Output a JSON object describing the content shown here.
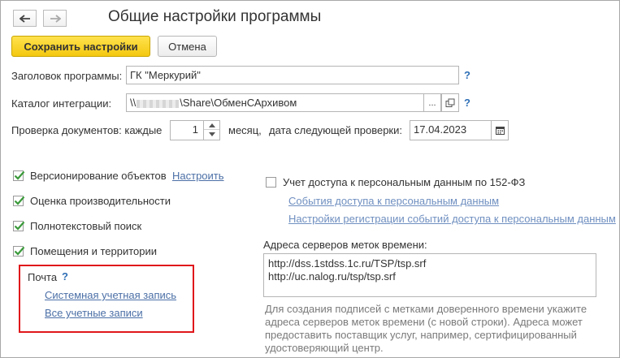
{
  "window": {
    "title": "Общие настройки программы",
    "back_icon": "arrow-left-icon",
    "forward_icon": "arrow-right-icon"
  },
  "toolbar": {
    "save_label": "Сохранить настройки",
    "cancel_label": "Отмена"
  },
  "fields": {
    "title_label": "Заголовок программы:",
    "title_value": "ГК \"Меркурий\"",
    "catalog_label": "Каталог интеграции:",
    "catalog_value_prefix": "\\\\",
    "catalog_value_suffix": "\\Share\\ОбменСАрхивом",
    "catalog_select_label": "...",
    "help": "?"
  },
  "doc_check": {
    "label": "Проверка документов:  каждые",
    "value": "1",
    "unit": "месяц,",
    "next_label": "дата следующей проверки:",
    "next_date": "17.04.2023"
  },
  "left_options": [
    {
      "label": "Версионирование объектов",
      "checked": true
    },
    {
      "label": "Оценка производительности",
      "checked": true
    },
    {
      "label": "Полнотекстовый поиск",
      "checked": true
    },
    {
      "label": "Помещения и территории",
      "checked": true
    }
  ],
  "versioning_link": "Настроить",
  "mail": {
    "label": "Почта",
    "help": "?",
    "links": [
      "Системная учетная запись",
      "Все учетные записи"
    ]
  },
  "personal_data": {
    "label": "Учет доступа к персональным данным по 152-ФЗ",
    "checked": false,
    "links": [
      "События доступа к персональным данным",
      "Настройки регистрации событий доступа к персональным данным"
    ]
  },
  "timestamp": {
    "label": "Адреса серверов меток времени:",
    "lines": [
      "http://dss.1stdss.1c.ru/TSP/tsp.srf",
      "http://uc.nalog.ru/tsp/tsp.srf"
    ],
    "hint": "Для создания подписей с метками доверенного времени укажите адреса серверов меток времени (с новой строки). Адреса может предоставить поставщик услуг, например, сертифицированный удостоверяющий центр."
  },
  "colors": {
    "accent_button": "#f4c810",
    "link": "#4b6fa6",
    "highlight_box": "#e0171b",
    "checkmark": "#3a9a3a"
  }
}
